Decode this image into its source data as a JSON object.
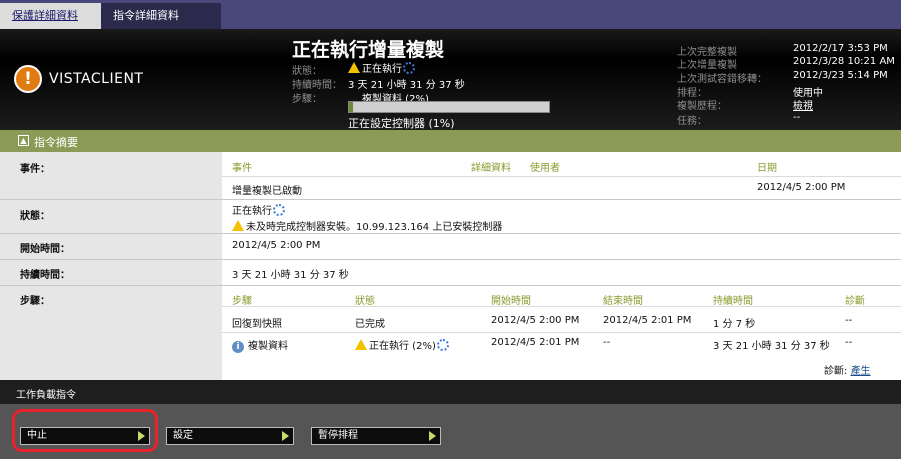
{
  "tabs": {
    "protect": "保護詳細資料",
    "command": "指令詳細資料"
  },
  "header": {
    "client": "VISTACLIENT",
    "op_title": "正在執行增量複製",
    "status_label": "狀態：",
    "status_value": "正在執行",
    "duration_label": "持續時間：",
    "duration_value": "3 天 21 小時 31 分 37 秒",
    "step_label": "步驟：",
    "step_value": "複製資料 (2%)",
    "progress": 0.02,
    "sub_step": "正在設定控制器 (1%)",
    "right": {
      "last_full_label": "上次完整複製",
      "last_full_value": "2012/2/17 3:53 PM",
      "last_incr_label": "上次增量複製",
      "last_incr_value": "2012/3/28 10:21 AM",
      "last_test_label": "上次測試容錯移轉：",
      "last_test_value": "2012/3/23 5:14 PM",
      "schedule_label": "排程：",
      "schedule_value": "使用中",
      "history_label": "複製歷程：",
      "history_value": "檢視",
      "task_label": "任務：",
      "task_value": "--"
    }
  },
  "summary": {
    "title": "指令摘要",
    "labels": {
      "event": "事件：",
      "status": "狀態：",
      "start": "開始時間：",
      "duration": "持續時間：",
      "steps": "步驟："
    },
    "event_headers": {
      "event": "事件",
      "details": "詳細資料",
      "user": "使用者",
      "date": "日期"
    },
    "event_row": {
      "event": "增量複製已啟動",
      "date": "2012/4/5 2:00 PM"
    },
    "status_line1": "正在執行",
    "status_line2": "未及時完成控制器安裝。10.99.123.164 上已安裝控制器",
    "start_time": "2012/4/5 2:00 PM",
    "duration": "3 天 21 小時 31 分 37 秒",
    "step_headers": {
      "step": "步驟",
      "status": "狀態",
      "start": "開始時間",
      "end": "結束時間",
      "duration": "持續時間",
      "diag": "診斷"
    },
    "steps": [
      {
        "step": "回復到快照",
        "status": "已完成",
        "start": "2012/4/5 2:00 PM",
        "end": "2012/4/5 2:01 PM",
        "duration": "1 分 7 秒",
        "diag": "--"
      },
      {
        "step": "複製資料",
        "status": "正在執行 (2%)",
        "start": "2012/4/5 2:01 PM",
        "end": "--",
        "duration": "3 天 21 小時 31 分 37 秒",
        "diag": "--"
      }
    ],
    "diag_label": "診斷:",
    "diag_link": "產生"
  },
  "actions": {
    "title": "工作負載指令",
    "buttons": [
      "中止",
      "設定",
      "暫停排程"
    ]
  },
  "colors": {
    "accent": "#8b9a55",
    "highlight": "#e8212a",
    "warning": "#e07b12"
  }
}
